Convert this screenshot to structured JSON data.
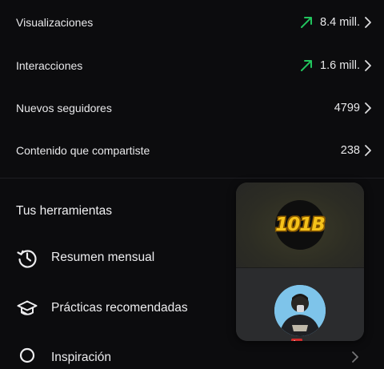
{
  "stats": [
    {
      "label": "Visualizaciones",
      "value": "8.4 mill.",
      "trend": "up"
    },
    {
      "label": "Interacciones",
      "value": "1.6 mill.",
      "trend": "up"
    },
    {
      "label": "Nuevos seguidores",
      "value": "4799",
      "trend": ""
    },
    {
      "label": "Contenido que compartiste",
      "value": "238",
      "trend": ""
    }
  ],
  "tools": {
    "title": "Tus herramientas",
    "items": [
      {
        "label": "Resumen mensual",
        "icon": "history-icon"
      },
      {
        "label": "Prácticas recomendadas",
        "icon": "graduation-cap-icon"
      },
      {
        "label": "Inspiración",
        "icon": "lightbulb-icon"
      }
    ]
  },
  "pip": {
    "badge_text": "101B",
    "avatar_icon": "avatar",
    "cast_icon": "cast-icon"
  },
  "colors": {
    "background": "#0c0c0e",
    "trend_green": "#22c55e",
    "pip_panel": "#2a2a2c",
    "badge_yellow": "#f5c21a"
  }
}
